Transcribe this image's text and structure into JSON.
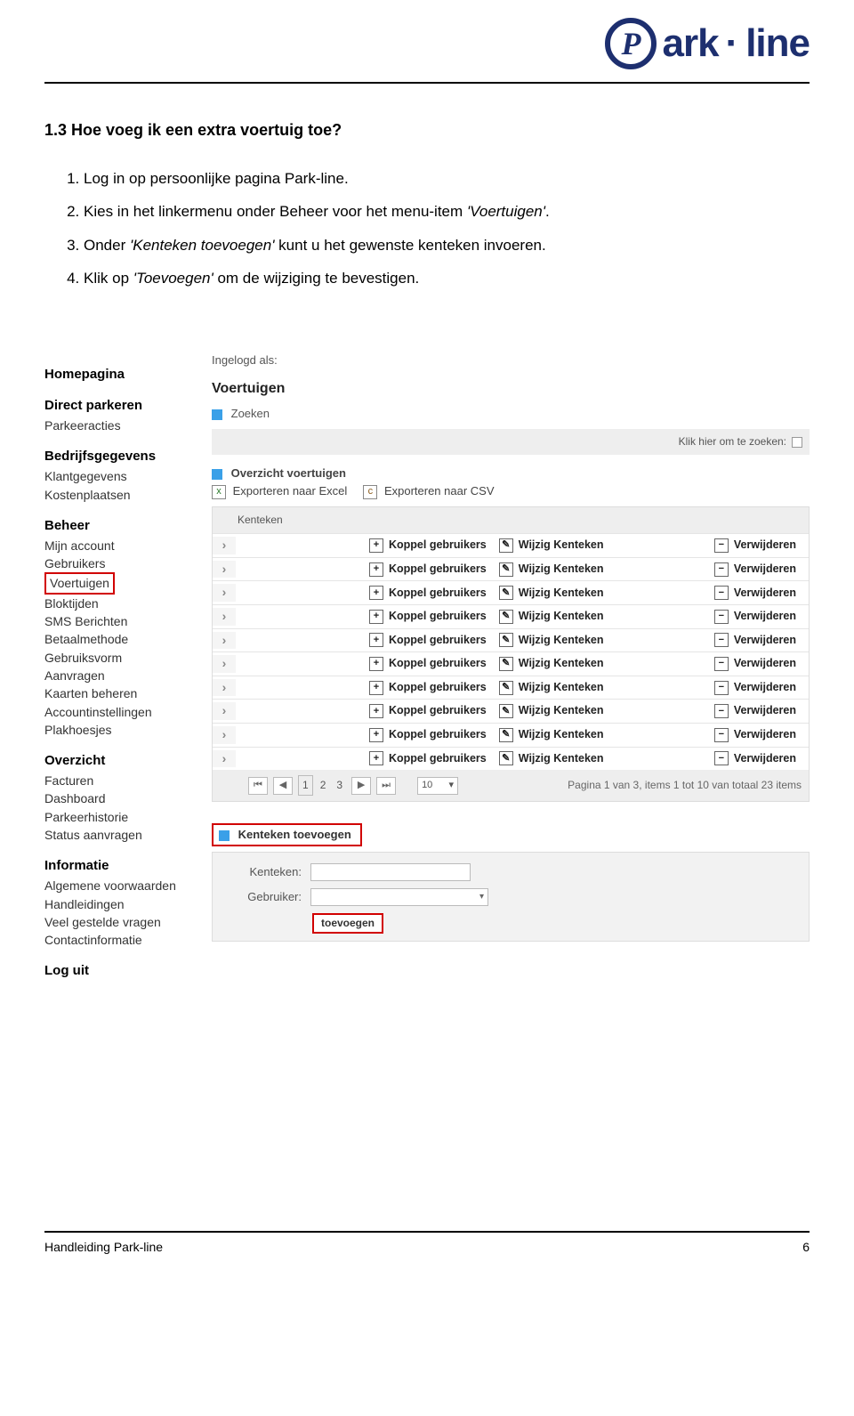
{
  "logo": {
    "mark_letter": "P",
    "word1": "ark",
    "dot": "·",
    "word2": "line"
  },
  "heading": "1.3  Hoe voeg ik een extra voertuig toe?",
  "steps": [
    {
      "pre": "Log in op persoonlijke pagina Park-line."
    },
    {
      "pre": "Kies in het linkermenu onder Beheer voor het menu-item ",
      "em": "'Voertuigen'",
      "post": "."
    },
    {
      "pre": "Onder ",
      "em": "'Kenteken toevoegen'",
      "post": " kunt u het gewenste kenteken invoeren."
    },
    {
      "pre": "Klik op ",
      "em": "'Toevoegen'",
      "post": " om de wijziging te bevestigen."
    }
  ],
  "sidebar": [
    {
      "header": "Homepagina"
    },
    {
      "header": "Direct parkeren",
      "items": [
        "Parkeeracties"
      ]
    },
    {
      "header": "Bedrijfsgegevens",
      "items": [
        "Klantgegevens",
        "Kostenplaatsen"
      ]
    },
    {
      "header": "Beheer",
      "items": [
        "Mijn account",
        "Gebruikers",
        {
          "label": "Voertuigen",
          "highlight": true
        },
        "Bloktijden",
        "SMS Berichten",
        "Betaalmethode",
        "Gebruiksvorm",
        "Aanvragen",
        "Kaarten beheren",
        "Accountinstellingen",
        "Plakhoesjes"
      ]
    },
    {
      "header": "Overzicht",
      "items": [
        "Facturen",
        "Dashboard",
        "Parkeerhistorie",
        "Status aanvragen"
      ]
    },
    {
      "header": "Informatie",
      "items": [
        "Algemene voorwaarden",
        "Handleidingen",
        "Veel gestelde vragen",
        "Contactinformatie"
      ]
    },
    {
      "header": "Log uit"
    }
  ],
  "main": {
    "logged_in_label": "Ingelogd als:",
    "title": "Voertuigen",
    "search_title": "Zoeken",
    "search_hint": "Klik hier om te zoeken:",
    "overview_title": "Overzicht voertuigen",
    "export_excel": "Exporteren naar Excel",
    "export_csv": "Exporteren naar CSV",
    "table": {
      "header": "Kenteken",
      "actions": {
        "koppel": "Koppel gebruikers",
        "wijzig": "Wijzig Kenteken",
        "verwijder": "Verwijderen"
      },
      "row_count": 10
    },
    "pager": {
      "pages": [
        "1",
        "2",
        "3"
      ],
      "page_size": "10",
      "status": "Pagina 1 van 3, items 1 tot 10 van totaal 23 items"
    },
    "add": {
      "title": "Kenteken toevoegen",
      "kenteken_label": "Kenteken:",
      "gebruiker_label": "Gebruiker:",
      "button": "toevoegen"
    }
  },
  "footer": {
    "left": "Handleiding Park-line",
    "right": "6"
  }
}
